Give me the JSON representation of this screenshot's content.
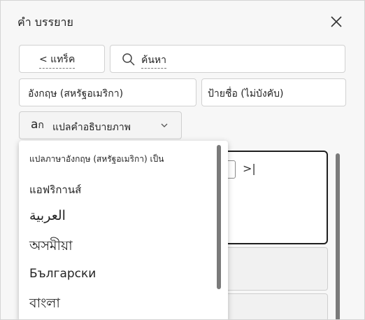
{
  "pane": {
    "title": "คำ บรรยาย"
  },
  "toolbar": {
    "back_label": "< แทร็ค",
    "search_placeholder": "ค้นหา"
  },
  "fields": {
    "language": "อังกฤษ (สหรัฐอเมริกา)",
    "label_optional": "ป้ายชื่อ (ไม่บังคับ)"
  },
  "translate_button": {
    "label": "แปลคำอธิบายภาพ",
    "icon": "translate-icon"
  },
  "dropdown": {
    "header": "แปลภาษาอังกฤษ (สหรัฐอเมริกา) เป็น",
    "items": [
      "แอฟริกานส์",
      "العربية",
      "অসমীয়া",
      "Български",
      "বাংলা"
    ]
  },
  "icons": {
    "close": "close-icon",
    "search": "search-icon",
    "chevron": "chevron-down-icon",
    "skip": "skip-forward-icon"
  }
}
